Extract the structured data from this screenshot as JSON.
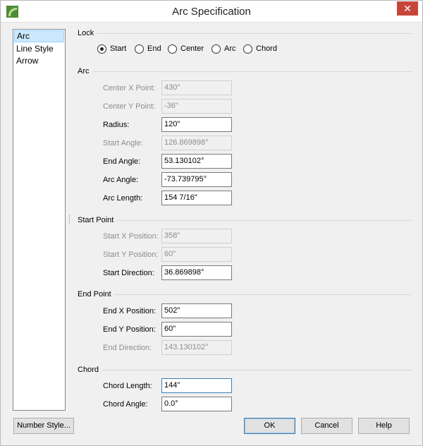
{
  "window": {
    "title": "Arc Specification",
    "close_glyph": "✕"
  },
  "sidebar": {
    "items": [
      {
        "label": "Arc",
        "selected": true
      },
      {
        "label": "Line Style",
        "selected": false
      },
      {
        "label": "Arrow",
        "selected": false
      }
    ]
  },
  "lock": {
    "heading": "Lock",
    "options": [
      "Start",
      "End",
      "Center",
      "Arc",
      "Chord"
    ],
    "selected": "Start"
  },
  "arc": {
    "heading": "Arc",
    "center_x": {
      "label": "Center X Point:",
      "value": "430\""
    },
    "center_y": {
      "label": "Center Y Point:",
      "value": "-36\""
    },
    "radius": {
      "label": "Radius:",
      "value": "120\""
    },
    "start_angle": {
      "label": "Start Angle:",
      "value": "126.869898°"
    },
    "end_angle": {
      "label": "End Angle:",
      "value": "53.130102°"
    },
    "arc_angle": {
      "label": "Arc Angle:",
      "value": "-73.739795°"
    },
    "arc_length": {
      "label": "Arc Length:",
      "value": "154 7/16\""
    }
  },
  "start_point": {
    "heading": "Start Point",
    "x": {
      "label": "Start X Position:",
      "value": "358\""
    },
    "y": {
      "label": "Start Y Position:",
      "value": "60\""
    },
    "direction": {
      "label": "Start Direction:",
      "value": "36.869898°"
    }
  },
  "end_point": {
    "heading": "End Point",
    "x": {
      "label": "End X Position:",
      "value": "502\""
    },
    "y": {
      "label": "End Y Position:",
      "value": "60\""
    },
    "direction": {
      "label": "End Direction:",
      "value": "143.130102°"
    }
  },
  "chord": {
    "heading": "Chord",
    "length": {
      "label": "Chord Length:",
      "value": "144\""
    },
    "angle": {
      "label": "Chord Angle:",
      "value": "0.0°"
    }
  },
  "buttons": {
    "number_style": "Number Style...",
    "ok": "OK",
    "cancel": "Cancel",
    "help": "Help"
  },
  "colors": {
    "accent": "#3c7fb1",
    "close": "#c7463c",
    "selection": "#cce8ff"
  },
  "icons": {
    "app": "chief-architect-logo-icon",
    "close": "close-icon"
  }
}
